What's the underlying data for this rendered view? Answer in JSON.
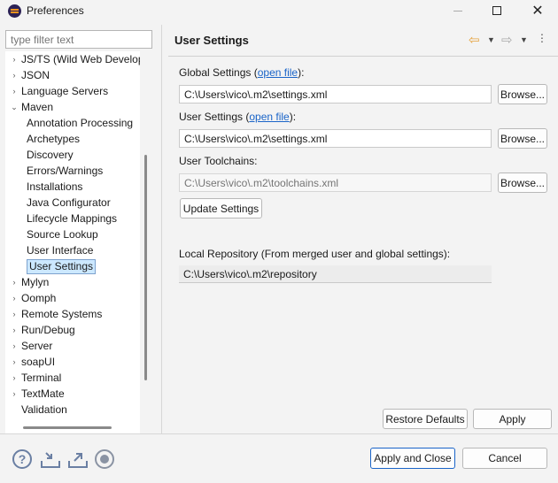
{
  "window": {
    "title": "Preferences"
  },
  "filter": {
    "placeholder": "type filter text"
  },
  "tree": {
    "items": [
      {
        "label": "JS/TS (Wild Web Developer)",
        "toggle": "›",
        "indent": 0
      },
      {
        "label": "JSON",
        "toggle": "›",
        "indent": 0
      },
      {
        "label": "Language Servers",
        "toggle": "›",
        "indent": 0
      },
      {
        "label": "Maven",
        "toggle": "⌄",
        "indent": 0
      },
      {
        "label": "Annotation Processing",
        "toggle": "",
        "indent": 1
      },
      {
        "label": "Archetypes",
        "toggle": "",
        "indent": 1
      },
      {
        "label": "Discovery",
        "toggle": "",
        "indent": 1
      },
      {
        "label": "Errors/Warnings",
        "toggle": "",
        "indent": 1
      },
      {
        "label": "Installations",
        "toggle": "",
        "indent": 1
      },
      {
        "label": "Java Configurator",
        "toggle": "",
        "indent": 1
      },
      {
        "label": "Lifecycle Mappings",
        "toggle": "",
        "indent": 1
      },
      {
        "label": "Source Lookup",
        "toggle": "",
        "indent": 1
      },
      {
        "label": "User Interface",
        "toggle": "",
        "indent": 1
      },
      {
        "label": "User Settings",
        "toggle": "",
        "indent": 1,
        "selected": true
      },
      {
        "label": "Mylyn",
        "toggle": "›",
        "indent": 0
      },
      {
        "label": "Oomph",
        "toggle": "›",
        "indent": 0
      },
      {
        "label": "Remote Systems",
        "toggle": "›",
        "indent": 0
      },
      {
        "label": "Run/Debug",
        "toggle": "›",
        "indent": 0
      },
      {
        "label": "Server",
        "toggle": "›",
        "indent": 0
      },
      {
        "label": "soapUI",
        "toggle": "›",
        "indent": 0
      },
      {
        "label": "Terminal",
        "toggle": "›",
        "indent": 0
      },
      {
        "label": "TextMate",
        "toggle": "›",
        "indent": 0
      },
      {
        "label": "Validation",
        "toggle": "",
        "indent": 0
      }
    ]
  },
  "page": {
    "title": "User Settings",
    "global_label": "Global Settings (",
    "global_link": "open file",
    "global_suffix": "):",
    "global_value": "C:\\Users\\vico\\.m2\\settings.xml",
    "user_label": "User Settings (",
    "user_link": "open file",
    "user_suffix": "):",
    "user_value": "C:\\Users\\vico\\.m2\\settings.xml",
    "toolchains_label": "User Toolchains:",
    "toolchains_placeholder": "C:\\Users\\vico\\.m2\\toolchains.xml",
    "browse": "Browse...",
    "update": "Update Settings",
    "repo_label": "Local Repository (From merged user and global settings):",
    "repo_value": "C:\\Users\\vico\\.m2\\repository",
    "restore": "Restore Defaults",
    "apply": "Apply"
  },
  "footer": {
    "apply_close": "Apply and Close",
    "cancel": "Cancel"
  },
  "colors": {
    "accent": "#1a64c8",
    "selection": "#cce8ff"
  }
}
